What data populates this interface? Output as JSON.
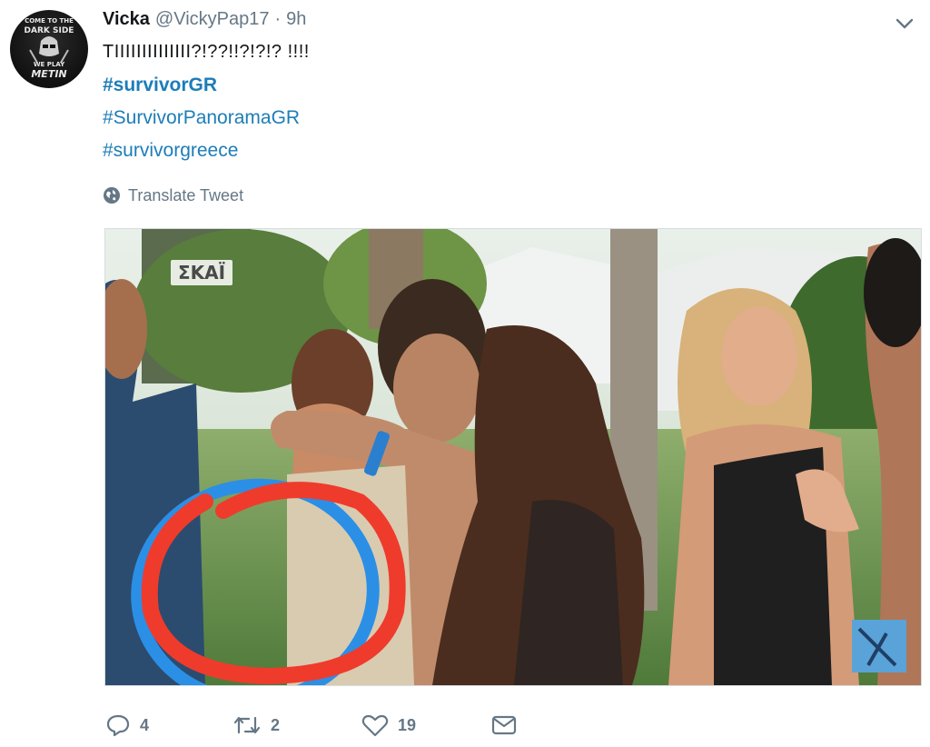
{
  "tweet": {
    "author_name": "Vicka",
    "handle": "@VickyPap17",
    "separator": "·",
    "time": "9h",
    "text": "TIIIIIIIIIIIIII?!??!!?!?!?  !!!!",
    "hashtags": [
      "#survivorGR",
      "#SurvivorPanoramaGR",
      "#survivorgreece"
    ],
    "translate_label": "Translate Tweet",
    "avatar_text": [
      "COME TO THE",
      "DARK SIDE",
      "WE PLAY",
      "METIN"
    ]
  },
  "media": {
    "channel_logo": "ΣΚΑΪ"
  },
  "actions": {
    "replies": "4",
    "retweets": "2",
    "likes": "19"
  },
  "colors": {
    "link": "#1c7db8",
    "muted": "#657786",
    "annotation_red": "#ef3b2c",
    "annotation_blue": "#2b8fe6"
  },
  "icons": [
    "globe-icon",
    "chevron-down-icon",
    "reply-icon",
    "retweet-icon",
    "like-icon",
    "message-icon"
  ]
}
